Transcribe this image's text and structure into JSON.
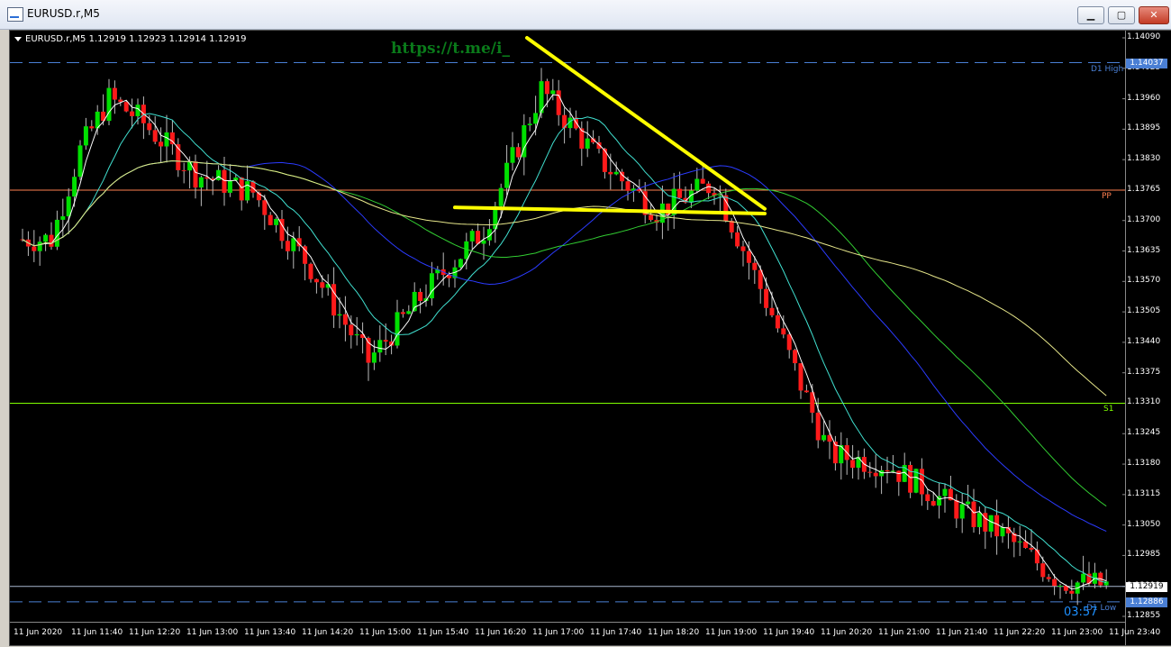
{
  "window": {
    "title": "EURUSD.r,M5",
    "min_label": "▁",
    "max_label": "▢",
    "close_label": "✕"
  },
  "chart": {
    "symbol_line": "EURUSD.r,M5  1.12919 1.12923 1.12914 1.12919",
    "watermark": "https://t.me/i_",
    "timer": "03:57",
    "y_ticks": [
      "1.14090",
      "1.14025",
      "1.13960",
      "1.13895",
      "1.13830",
      "1.13765",
      "1.13700",
      "1.13635",
      "1.13570",
      "1.13505",
      "1.13440",
      "1.13375",
      "1.13310",
      "1.13245",
      "1.13180",
      "1.13115",
      "1.13050",
      "1.12985",
      "1.12919",
      "1.12855"
    ],
    "x_ticks": [
      "11 Jun 2020",
      "11 Jun 11:40",
      "11 Jun 12:20",
      "11 Jun 13:00",
      "11 Jun 13:40",
      "11 Jun 14:20",
      "11 Jun 15:00",
      "11 Jun 15:40",
      "11 Jun 16:20",
      "11 Jun 17:00",
      "11 Jun 17:40",
      "11 Jun 18:20",
      "11 Jun 19:00",
      "11 Jun 19:40",
      "11 Jun 20:20",
      "11 Jun 21:00",
      "11 Jun 21:40",
      "11 Jun 22:20",
      "11 Jun 23:00",
      "11 Jun 23:40"
    ],
    "levels": {
      "d1_high": {
        "label": "D1 High",
        "price": "1.14037",
        "value": 1.14037,
        "color": "#4a7fd4"
      },
      "pp": {
        "label": "PP",
        "value": 1.13765,
        "color": "#ff7f50"
      },
      "s1": {
        "label": "S1",
        "value": 1.1331,
        "color": "#7fff00"
      },
      "current": {
        "price": "1.12919",
        "value": 1.12919,
        "color": "#a9b7d0"
      },
      "d1_low": {
        "label": "D1 Low",
        "price": "1.12886",
        "value": 1.12886,
        "color": "#4a7fd4"
      }
    },
    "colors": {
      "bull": "#00e000",
      "bear": "#ff1a1a",
      "trend": "#ffff00",
      "background": "#000000"
    }
  },
  "chart_data": {
    "type": "candlestick",
    "x_range": [
      "11 Jun 2020",
      "11 Jun 23:40"
    ],
    "ylim": [
      1.12855,
      1.1409
    ],
    "price_path": [
      {
        "x": "11 Jun 11:20",
        "price": 1.1366
      },
      {
        "x": "11 Jun 11:40",
        "price": 1.1385
      },
      {
        "x": "11 Jun 12:00",
        "price": 1.1396
      },
      {
        "x": "11 Jun 12:20",
        "price": 1.1392
      },
      {
        "x": "11 Jun 13:00",
        "price": 1.138
      },
      {
        "x": "11 Jun 13:40",
        "price": 1.1376
      },
      {
        "x": "11 Jun 14:20",
        "price": 1.136
      },
      {
        "x": "11 Jun 15:00",
        "price": 1.134
      },
      {
        "x": "11 Jun 15:40",
        "price": 1.1355
      },
      {
        "x": "11 Jun 16:20",
        "price": 1.1368
      },
      {
        "x": "11 Jun 17:00",
        "price": 1.1398
      },
      {
        "x": "11 Jun 17:40",
        "price": 1.1383
      },
      {
        "x": "11 Jun 18:20",
        "price": 1.1372
      },
      {
        "x": "11 Jun 19:00",
        "price": 1.1378
      },
      {
        "x": "11 Jun 19:40",
        "price": 1.135
      },
      {
        "x": "11 Jun 20:20",
        "price": 1.132
      },
      {
        "x": "11 Jun 21:00",
        "price": 1.1318
      },
      {
        "x": "11 Jun 21:40",
        "price": 1.131
      },
      {
        "x": "11 Jun 22:20",
        "price": 1.1303
      },
      {
        "x": "11 Jun 23:00",
        "price": 1.1293
      },
      {
        "x": "11 Jun 23:40",
        "price": 1.12919
      }
    ],
    "trendlines": [
      {
        "from": {
          "x": "11 Jun 16:50",
          "price": 1.1409
        },
        "to": {
          "x": "11 Jun 19:35",
          "price": 1.13725
        }
      },
      {
        "from": {
          "x": "11 Jun 16:00",
          "price": 1.13728
        },
        "to": {
          "x": "11 Jun 19:35",
          "price": 1.13715
        }
      }
    ]
  }
}
